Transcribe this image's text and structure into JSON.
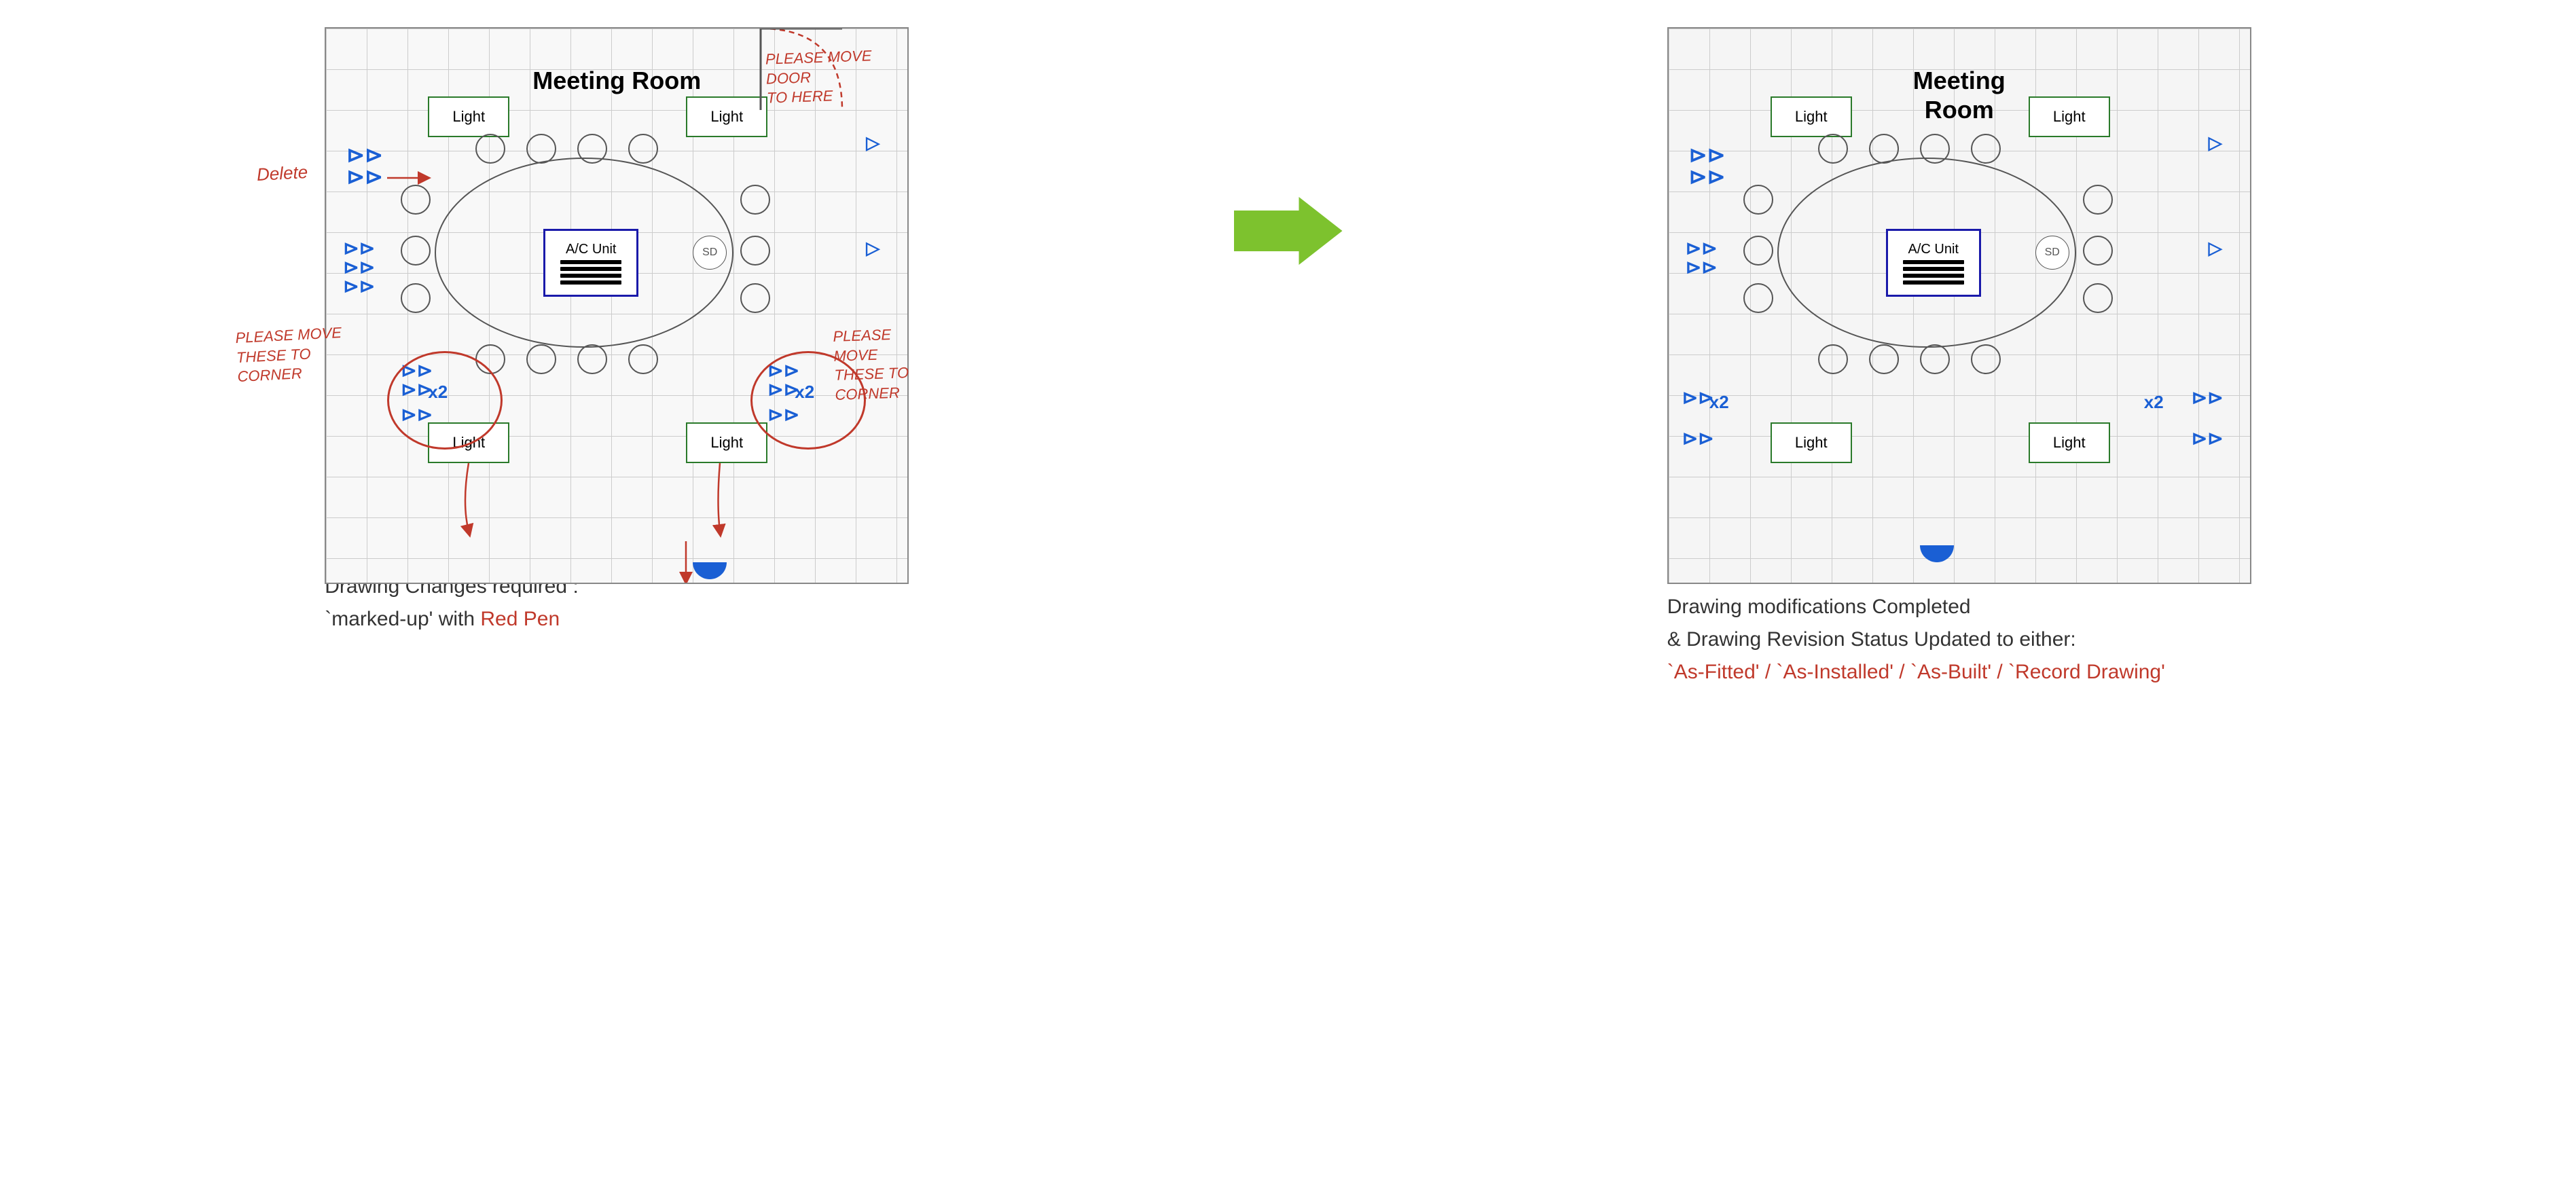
{
  "left": {
    "room_label": "Meeting\nRoom",
    "lights": [
      {
        "id": "light-tl",
        "label": "Light"
      },
      {
        "id": "light-tr",
        "label": "Light"
      },
      {
        "id": "light-bl",
        "label": "Light"
      },
      {
        "id": "light-br",
        "label": "Light"
      }
    ],
    "ac_label": "A/C Unit",
    "sd_label": "SD",
    "x2_labels": [
      "x2",
      "x2"
    ],
    "red_annotations": {
      "delete": "Delete",
      "please_move_1": "PLEASE MOVE\nTHESE TO\nCORNER",
      "please_move_2": "PLEASE MOVE\nTHESE TO CORNER",
      "please_move_door": "PLEASE MOVE DOOR\nTO HERE",
      "move1": "move",
      "move2": "move",
      "move3": "move"
    },
    "description_line1": "Drawing  Changes required :",
    "description_line2_prefix": "`marked-up' with ",
    "description_line2_red": "Red Pen"
  },
  "arrow": {
    "label": "→"
  },
  "right": {
    "room_label": "Meeting\nRoom",
    "lights": [
      {
        "id": "light-tl",
        "label": "Light"
      },
      {
        "id": "light-tr",
        "label": "Light"
      },
      {
        "id": "light-bl",
        "label": "Light"
      },
      {
        "id": "light-br",
        "label": "Light"
      }
    ],
    "ac_label": "A/C Unit",
    "sd_label": "SD",
    "x2_labels": [
      "x2",
      "x2"
    ],
    "description_line1": "Drawing modifications Completed",
    "description_line2": "& Drawing  Revision  Status  Updated  to either:",
    "description_line3_red": "`As-Fitted'  /  `As-Installed'  /  `As-Built' /  `Record Drawing'"
  }
}
